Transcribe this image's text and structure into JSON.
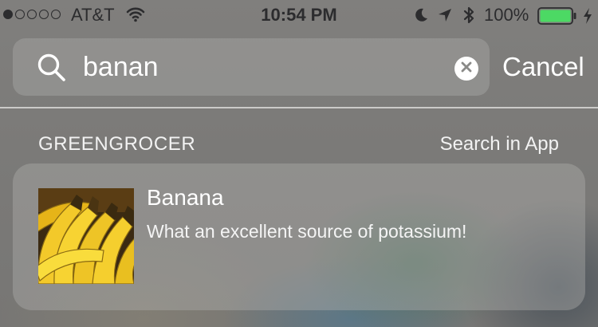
{
  "status_bar": {
    "signal_bars_filled": 1,
    "signal_bars_total": 5,
    "carrier": "AT&T",
    "time": "10:54 PM",
    "battery_percent": "100%",
    "battery_level": 1.0,
    "battery_color": "#4cd964",
    "icons": [
      "wifi-icon",
      "moon-icon",
      "location-icon",
      "bluetooth-icon",
      "battery-icon",
      "charging-icon"
    ]
  },
  "search": {
    "value": "banan",
    "cancel_label": "Cancel"
  },
  "section": {
    "title": "GREENGROCER",
    "action_label": "Search in App"
  },
  "result": {
    "title": "Banana",
    "subtitle": "What an excellent source of potassium!",
    "thumbnail": "banana-photo"
  }
}
